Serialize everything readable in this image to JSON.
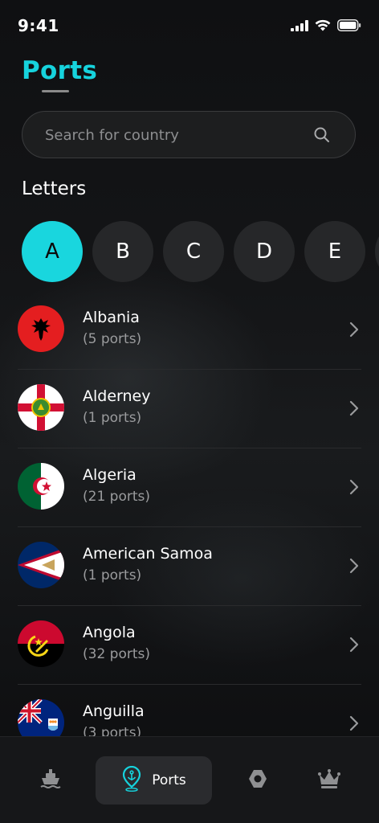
{
  "status_bar": {
    "time": "9:41",
    "icons": [
      "signal-icon",
      "wifi-icon",
      "battery-icon"
    ]
  },
  "page": {
    "title": "Ports",
    "accent_color": "#16d3dd"
  },
  "search": {
    "placeholder": "Search for country",
    "value": ""
  },
  "letters": {
    "heading": "Letters",
    "items": [
      "A",
      "B",
      "C",
      "D",
      "E"
    ],
    "selected": "A"
  },
  "countries": [
    {
      "name": "Albania",
      "ports": "(5 ports)",
      "flag": "albania-flag-icon"
    },
    {
      "name": "Alderney",
      "ports": "(1 ports)",
      "flag": "alderney-flag-icon"
    },
    {
      "name": "Algeria",
      "ports": "(21 ports)",
      "flag": "algeria-flag-icon"
    },
    {
      "name": "American Samoa",
      "ports": "(1 ports)",
      "flag": "american-samoa-flag-icon"
    },
    {
      "name": "Angola",
      "ports": "(32 ports)",
      "flag": "angola-flag-icon"
    },
    {
      "name": "Anguilla",
      "ports": "(3 ports)",
      "flag": "anguilla-flag-icon"
    }
  ],
  "bottom_nav": {
    "items": [
      {
        "icon": "ship-icon",
        "label": "",
        "active": false
      },
      {
        "icon": "port-pin-icon",
        "label": "Ports",
        "active": true
      },
      {
        "icon": "hexagon-nut-icon",
        "label": "",
        "active": false
      },
      {
        "icon": "crown-icon",
        "label": "",
        "active": false
      }
    ]
  }
}
